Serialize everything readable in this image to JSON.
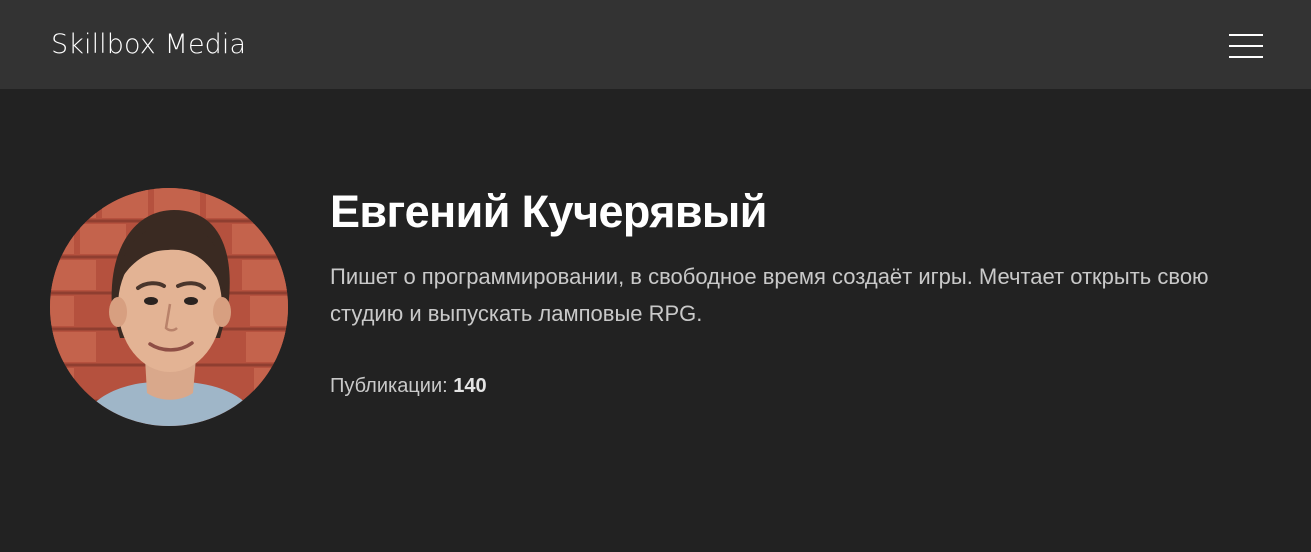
{
  "header": {
    "logo_text": "Skillbox Media",
    "menu_icon": "hamburger-menu-icon"
  },
  "author": {
    "name": "Евгений Кучерявый",
    "bio": "Пишет о программировании, в свободное время создаёт игры. Мечтает открыть свою студию и выпускать ламповые RPG.",
    "publications_label": "Публикации:",
    "publications_count": "140"
  },
  "colors": {
    "page_background": "#222222",
    "header_background": "#333333",
    "text_primary": "#ffffff",
    "text_secondary": "#c9c9c9"
  }
}
